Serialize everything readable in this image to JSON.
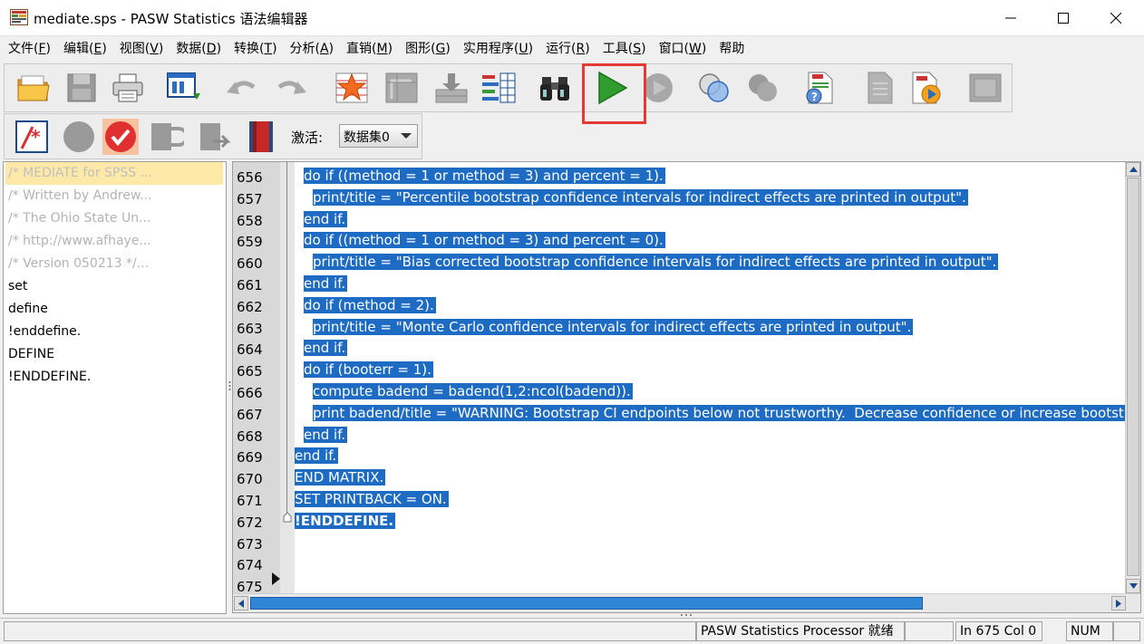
{
  "window": {
    "title": "mediate.sps - PASW Statistics 语法编辑器",
    "minimize": "minimize",
    "maximize": "maximize",
    "close": "close"
  },
  "menu": [
    {
      "pre": "文件(",
      "key": "F",
      "post": ")"
    },
    {
      "pre": "编辑(",
      "key": "E",
      "post": ")"
    },
    {
      "pre": "视图(",
      "key": "V",
      "post": ")"
    },
    {
      "pre": "数据(",
      "key": "D",
      "post": ")"
    },
    {
      "pre": "转换(",
      "key": "T",
      "post": ")"
    },
    {
      "pre": "分析(",
      "key": "A",
      "post": ")"
    },
    {
      "pre": "直销(",
      "key": "M",
      "post": ")"
    },
    {
      "pre": "图形(",
      "key": "G",
      "post": ")"
    },
    {
      "pre": "实用程序(",
      "key": "U",
      "post": ")"
    },
    {
      "pre": "运行(",
      "key": "R",
      "post": ")"
    },
    {
      "pre": "工具(",
      "key": "S",
      "post": ")"
    },
    {
      "pre": "窗口(",
      "key": "W",
      "post": ")"
    },
    {
      "pre": "帮助",
      "key": "",
      "post": ""
    }
  ],
  "toolbar2": {
    "activate_label": "激活:",
    "dataset_value": "数据集0"
  },
  "navigator": {
    "items": [
      {
        "text": "/* MEDIATE for SPSS ...",
        "style": "selected"
      },
      {
        "text": "/* Written by Andrew...",
        "style": "gray"
      },
      {
        "text": "/* The Ohio State Un...",
        "style": "gray"
      },
      {
        "text": "/* http://www.afhaye...",
        "style": "gray"
      },
      {
        "text": "/* Version 050213 */...",
        "style": "gray"
      },
      {
        "text": "set",
        "style": "normal"
      },
      {
        "text": "define",
        "style": "normal"
      },
      {
        "text": "!enddefine.",
        "style": "normal"
      },
      {
        "text": "DEFINE",
        "style": "normal"
      },
      {
        "text": "!ENDDEFINE.",
        "style": "normal"
      }
    ]
  },
  "editor": {
    "lines": [
      {
        "num": "656",
        "indent": 1,
        "text": "do if ((method = 1 or method = 3) and percent = 1).",
        "selected": true
      },
      {
        "num": "657",
        "indent": 2,
        "text": "print/title = \"Percentile bootstrap confidence intervals for indirect effects are printed in output\".",
        "selected": true
      },
      {
        "num": "658",
        "indent": 1,
        "text": "end if.",
        "selected": true
      },
      {
        "num": "659",
        "indent": 1,
        "text": "do if ((method = 1 or method = 3) and percent = 0).",
        "selected": true
      },
      {
        "num": "660",
        "indent": 2,
        "text": "print/title = \"Bias corrected bootstrap confidence intervals for indirect effects are printed in output\".",
        "selected": true
      },
      {
        "num": "661",
        "indent": 1,
        "text": "end if.",
        "selected": true
      },
      {
        "num": "662",
        "indent": 1,
        "text": "do if (method = 2).",
        "selected": true
      },
      {
        "num": "663",
        "indent": 2,
        "text": "print/title = \"Monte Carlo confidence intervals for indirect effects are printed in output\".",
        "selected": true
      },
      {
        "num": "664",
        "indent": 1,
        "text": "end if.",
        "selected": true
      },
      {
        "num": "665",
        "indent": 1,
        "text": "do if (booterr = 1).",
        "selected": true
      },
      {
        "num": "666",
        "indent": 2,
        "text": "compute badend = badend(1,2:ncol(badend)).",
        "selected": true
      },
      {
        "num": "667",
        "indent": 2,
        "text": "print badend/title = \"WARNING: Bootstrap CI endpoints below not trustworthy.  Decrease confidence or increase bootstraps\".",
        "selected": true
      },
      {
        "num": "668",
        "indent": 1,
        "text": "end if.",
        "selected": true
      },
      {
        "num": "669",
        "indent": 0,
        "text": "end if.",
        "selected": true
      },
      {
        "num": "670",
        "indent": 0,
        "text": "END MATRIX.",
        "selected": true
      },
      {
        "num": "671",
        "indent": 0,
        "text": "SET PRINTBACK = ON.",
        "selected": true
      },
      {
        "num": "672",
        "indent": 0,
        "text": "!ENDDEFINE.",
        "selected": true,
        "bold": true
      },
      {
        "num": "673",
        "indent": 0,
        "text": "",
        "selected": false
      },
      {
        "num": "674",
        "indent": 0,
        "text": "",
        "selected": false
      },
      {
        "num": "675",
        "indent": 0,
        "text": "",
        "selected": false
      }
    ]
  },
  "status": {
    "processor": "PASW Statistics Processor 就绪",
    "position": "In 675 Col 0",
    "num": "NUM"
  },
  "colors": {
    "selection": "#1e6bc4",
    "run_highlight": "#e53935",
    "nav_selected": "#ffe9a8"
  }
}
